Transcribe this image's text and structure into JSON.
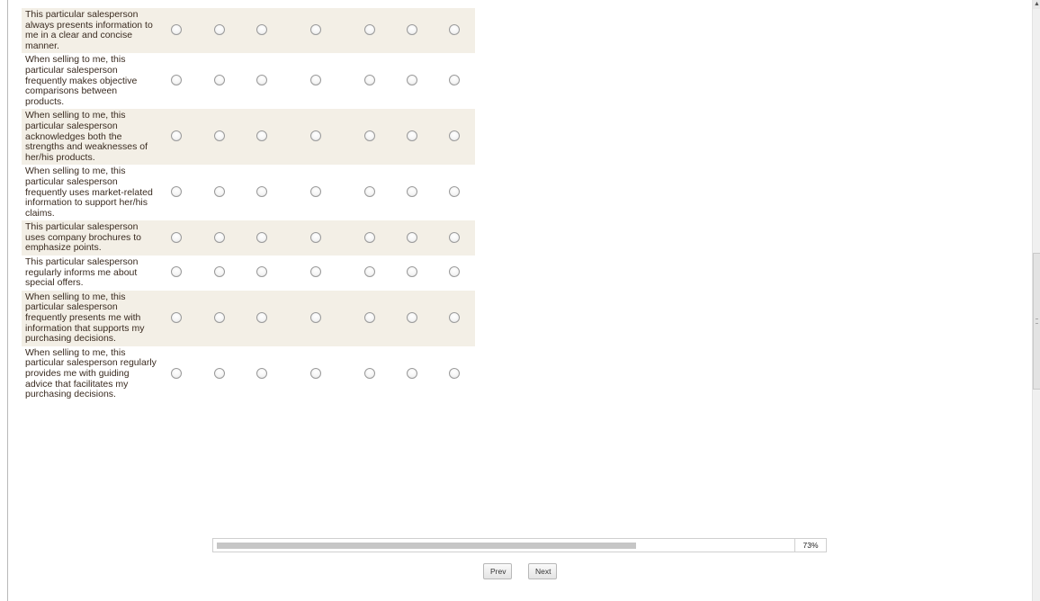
{
  "survey": {
    "items": [
      {
        "statement": "This particular salesperson always presents information to me in a clear and concise manner."
      },
      {
        "statement": "When selling to me, this particular salesperson frequently makes objective comparisons between products."
      },
      {
        "statement": "When selling to me, this particular salesperson acknowledges both the strengths and weaknesses of her/his products."
      },
      {
        "statement": "When selling to me, this particular salesperson frequently uses market-related information to support her/his claims."
      },
      {
        "statement": "This particular salesperson uses company brochures to emphasize points."
      },
      {
        "statement": "This particular salesperson regularly informs me about special offers."
      },
      {
        "statement": "When selling to me, this particular salesperson frequently presents me with information that supports my purchasing decisions."
      },
      {
        "statement": "When selling to me, this particular salesperson regularly provides me with guiding advice that facilitates my purchasing decisions."
      }
    ],
    "options_per_row": 7
  },
  "progress": {
    "percent": 73,
    "label": "73%"
  },
  "navigation": {
    "prev_label": "Prev",
    "next_label": "Next"
  },
  "scrollbar": {
    "up_arrow_icon": "chevron-up-icon"
  },
  "colors": {
    "row_alt_background": "#f3efe6",
    "text": "#3a2b20",
    "progress_fill": "#c6c6c6"
  }
}
